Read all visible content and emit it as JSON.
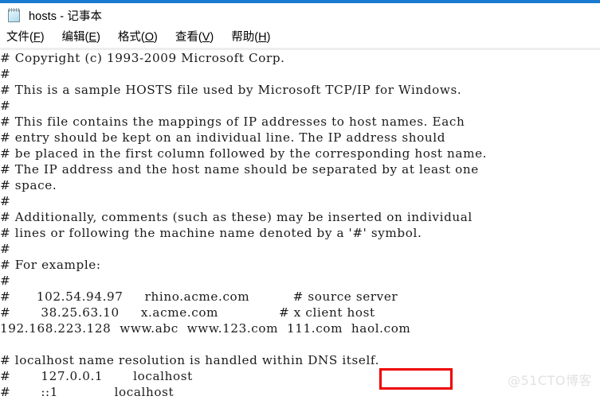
{
  "window": {
    "accent_color": "#1a7ad0",
    "title": "hosts - 记事本",
    "icon": "notepad-icon"
  },
  "menu": {
    "items": [
      {
        "label": "文件",
        "accel": "F"
      },
      {
        "label": "编辑",
        "accel": "E"
      },
      {
        "label": "格式",
        "accel": "O"
      },
      {
        "label": "查看",
        "accel": "V"
      },
      {
        "label": "帮助",
        "accel": "H"
      }
    ]
  },
  "editor": {
    "lines": [
      "# Copyright (c) 1993-2009 Microsoft Corp.",
      "#",
      "# This is a sample HOSTS file used by Microsoft TCP/IP for Windows.",
      "#",
      "# This file contains the mappings of IP addresses to host names. Each",
      "# entry should be kept on an individual line. The IP address should",
      "# be placed in the first column followed by the corresponding host name.",
      "# The IP address and the host name should be separated by at least one",
      "# space.",
      "#",
      "# Additionally, comments (such as these) may be inserted on individual",
      "# lines or following the machine name denoted by a '#' symbol.",
      "#",
      "# For example:",
      "#",
      "#      102.54.94.97     rhino.acme.com          # source server",
      "#       38.25.63.10     x.acme.com              # x client host",
      "192.168.223.128  www.abc  www.123.com  111.com  haol.com",
      "",
      "# localhost name resolution is handled within DNS itself.",
      "#       127.0.0.1       localhost",
      "#       ::1             localhost"
    ]
  },
  "annotation": {
    "target_text": "haol.com",
    "color": "#ee0000"
  },
  "watermark": {
    "text": "@51CTO博客"
  }
}
